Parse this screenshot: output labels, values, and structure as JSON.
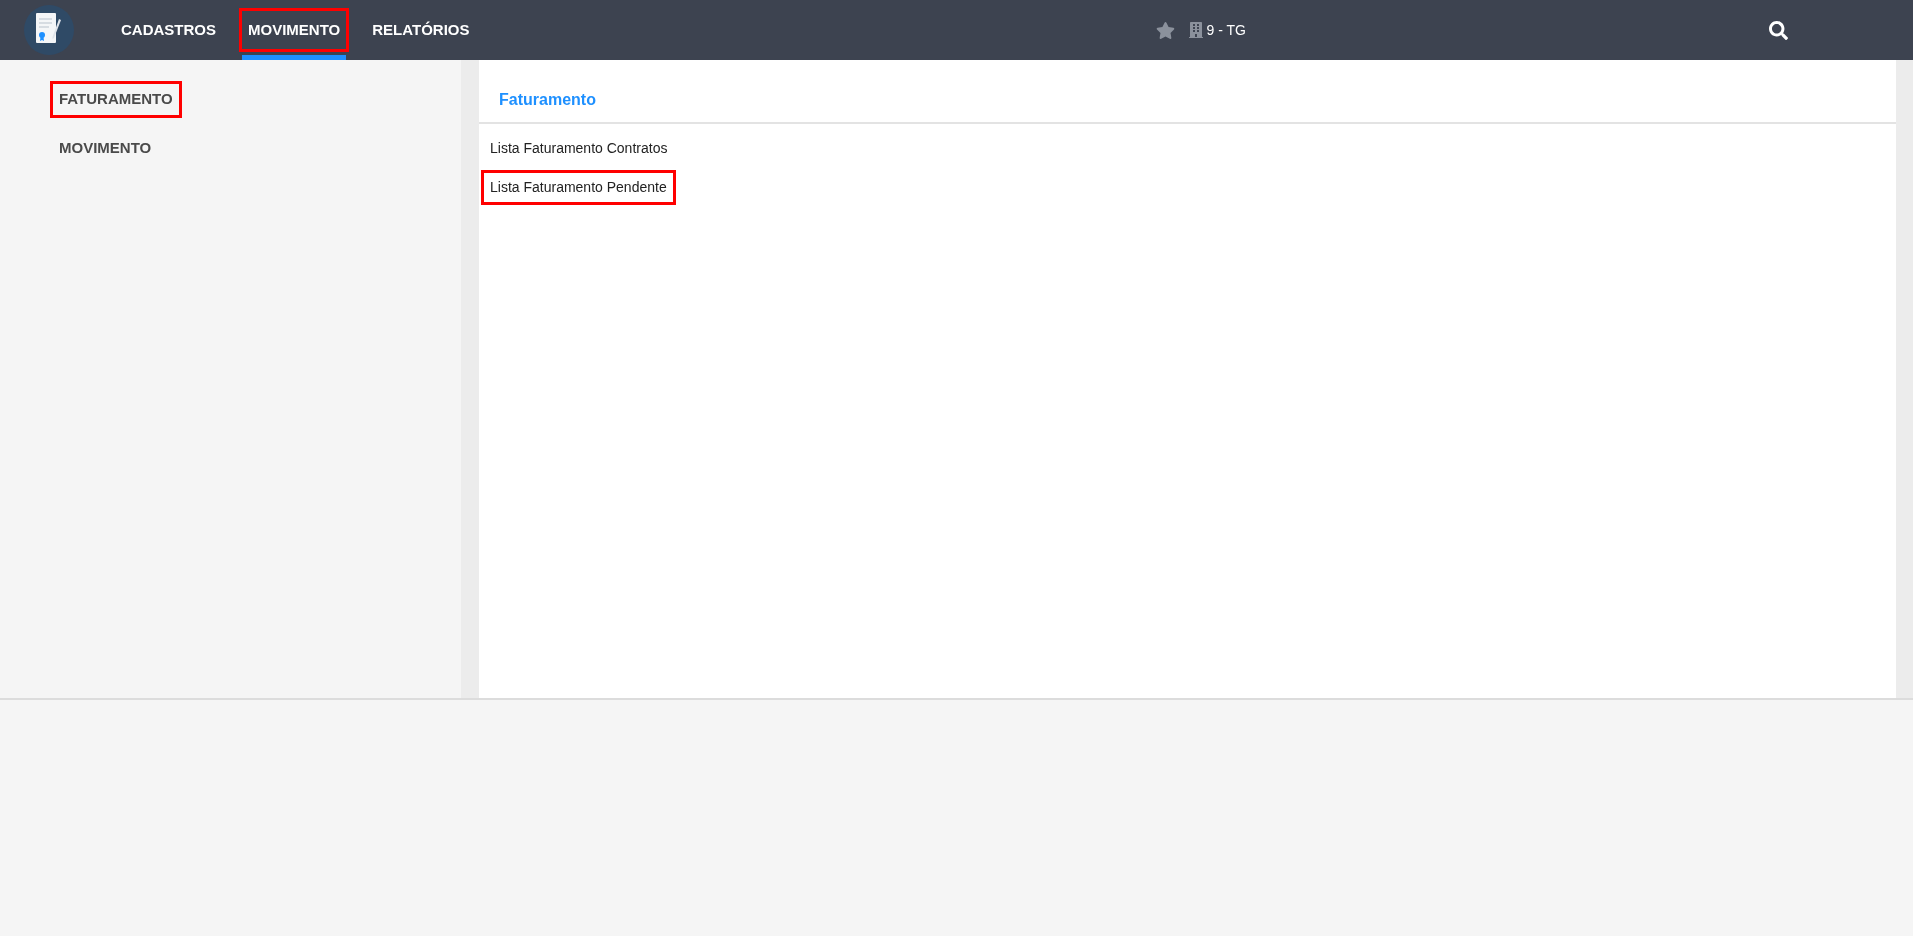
{
  "nav": [
    {
      "label": "CADASTROS",
      "selected": false,
      "highlighted": false
    },
    {
      "label": "MOVIMENTO",
      "selected": true,
      "highlighted": true
    },
    {
      "label": "RELATÓRIOS",
      "selected": false,
      "highlighted": false
    }
  ],
  "company": "9 - TG",
  "sidebar": {
    "items": [
      {
        "label": "FATURAMENTO",
        "highlighted": true
      },
      {
        "label": "MOVIMENTO",
        "highlighted": false
      }
    ]
  },
  "content": {
    "title": "Faturamento",
    "links": [
      {
        "label": "Lista Faturamento Contratos",
        "highlighted": false
      },
      {
        "label": "Lista Faturamento Pendente",
        "highlighted": true
      }
    ]
  }
}
